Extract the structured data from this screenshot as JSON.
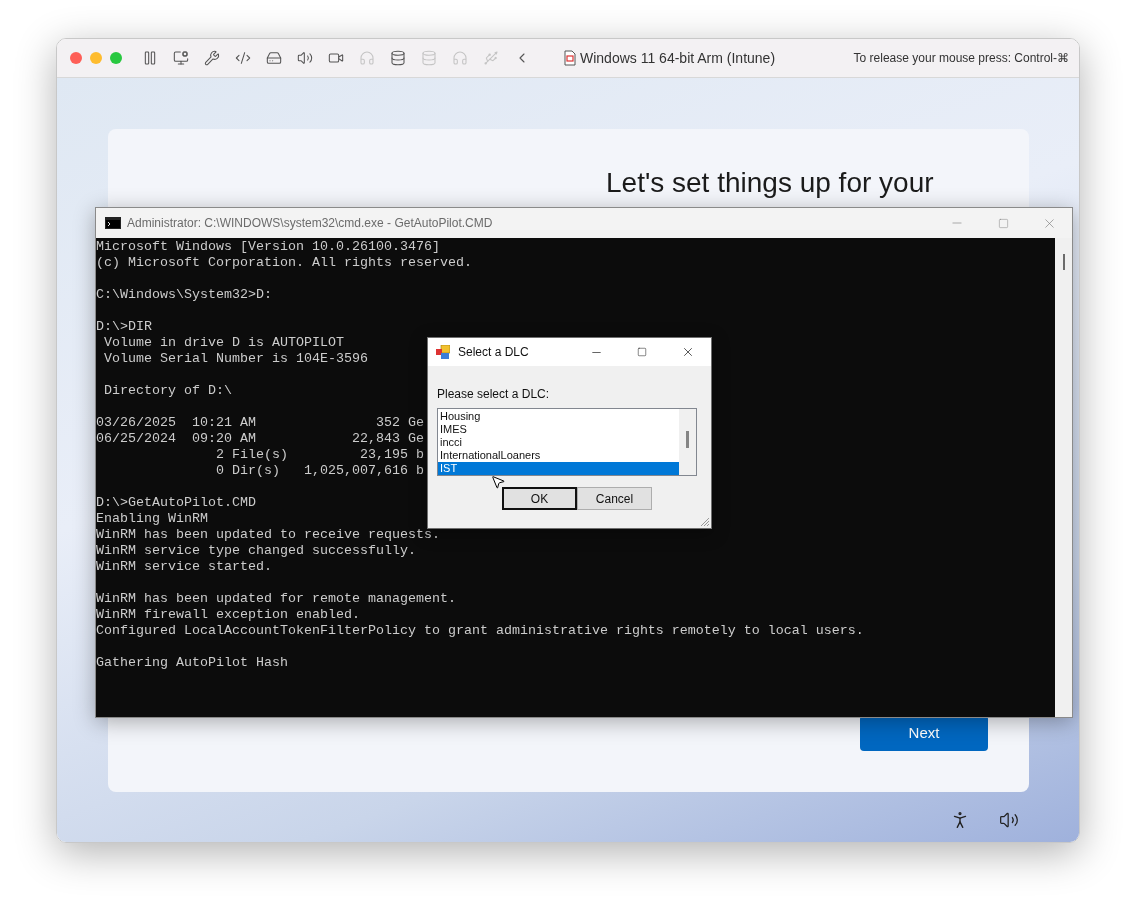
{
  "vm_window": {
    "title": "Windows 11 64-bit Arm (Intune)",
    "release_hint": "To release your mouse press: Control-⌘",
    "toolbar": [
      {
        "kind": "pause",
        "disabled": false
      },
      {
        "kind": "snapshot",
        "disabled": false
      },
      {
        "kind": "settings",
        "disabled": false
      },
      {
        "kind": "code",
        "disabled": false
      },
      {
        "kind": "drive",
        "disabled": false
      },
      {
        "kind": "sound",
        "disabled": false
      },
      {
        "kind": "camera",
        "disabled": false
      },
      {
        "kind": "headphones",
        "disabled": true
      },
      {
        "kind": "storage",
        "disabled": false
      },
      {
        "kind": "storage",
        "disabled": true
      },
      {
        "kind": "headphones",
        "disabled": true
      },
      {
        "kind": "usb",
        "disabled": true
      },
      {
        "kind": "back",
        "disabled": false
      }
    ]
  },
  "setup": {
    "heading": "Let's set things up for your",
    "next_button": "Next"
  },
  "console_window": {
    "title": "Administrator: C:\\WINDOWS\\system32\\cmd.exe - GetAutoPilot.CMD",
    "blocks": [
      [
        "Microsoft Windows [Version 10.0.26100.3476]",
        "(c) Microsoft Corporation. All rights reserved."
      ],
      [
        "C:\\Windows\\System32>D:"
      ],
      [
        "D:\\>DIR",
        " Volume in drive D is AUTOPILOT",
        " Volume Serial Number is 104E-3596"
      ],
      [
        " Directory of D:\\"
      ],
      [
        "03/26/2025  10:21 AM               352 Ge",
        "06/25/2024  09:20 AM            22,843 Ge",
        "               2 File(s)         23,195 b",
        "               0 Dir(s)   1,025,007,616 b"
      ],
      [
        "D:\\>GetAutoPilot.CMD",
        "Enabling WinRM",
        "WinRM has been updated to receive requests.",
        "WinRM service type changed successfully.",
        "WinRM service started."
      ],
      [
        "WinRM has been updated for remote management.",
        "WinRM firewall exception enabled.",
        "Configured LocalAccountTokenFilterPolicy to grant administrative rights remotely to local users."
      ],
      [
        "Gathering AutoPilot Hash"
      ]
    ]
  },
  "dialog": {
    "title": "Select a DLC",
    "prompt": "Please select a DLC:",
    "list_items": [
      {
        "label": "Housing",
        "selected": false
      },
      {
        "label": "IMES",
        "selected": false
      },
      {
        "label": "incci",
        "selected": false
      },
      {
        "label": "InternationalLoaners",
        "selected": false
      },
      {
        "label": "IST",
        "selected": true
      }
    ],
    "buttons": [
      "OK",
      "Cancel"
    ]
  }
}
